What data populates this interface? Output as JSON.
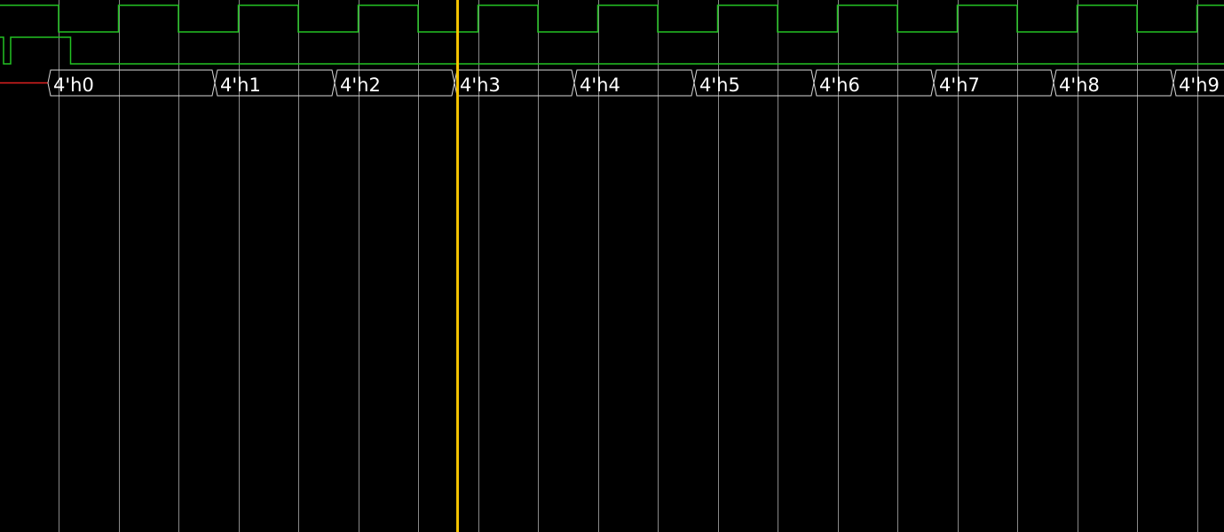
{
  "waveform_viewer": {
    "colors": {
      "background": "#000000",
      "grid": "#8a8a8a",
      "signal": "#22c322",
      "bus": "#d8d8d8",
      "undefined": "#e02020",
      "cursor": "#f5c400"
    },
    "time_scale": {
      "grid_divisions_per_clock_cycle": 2,
      "visible_clock_cycles": 10
    },
    "cursor": {
      "position_cycles": 3.33
    },
    "signals": [
      {
        "kind": "clock",
        "high_at_start": true,
        "first_rising_edge_cycles": -0.5
      },
      {
        "kind": "reset",
        "deassert_at_cycles": 0.1
      },
      {
        "kind": "bus",
        "values": [
          "4'h0",
          "4'h1",
          "4'h2",
          "4'h3",
          "4'h4",
          "4'h5",
          "4'h6",
          "4'h7",
          "4'h8",
          "4'h9"
        ]
      }
    ]
  }
}
